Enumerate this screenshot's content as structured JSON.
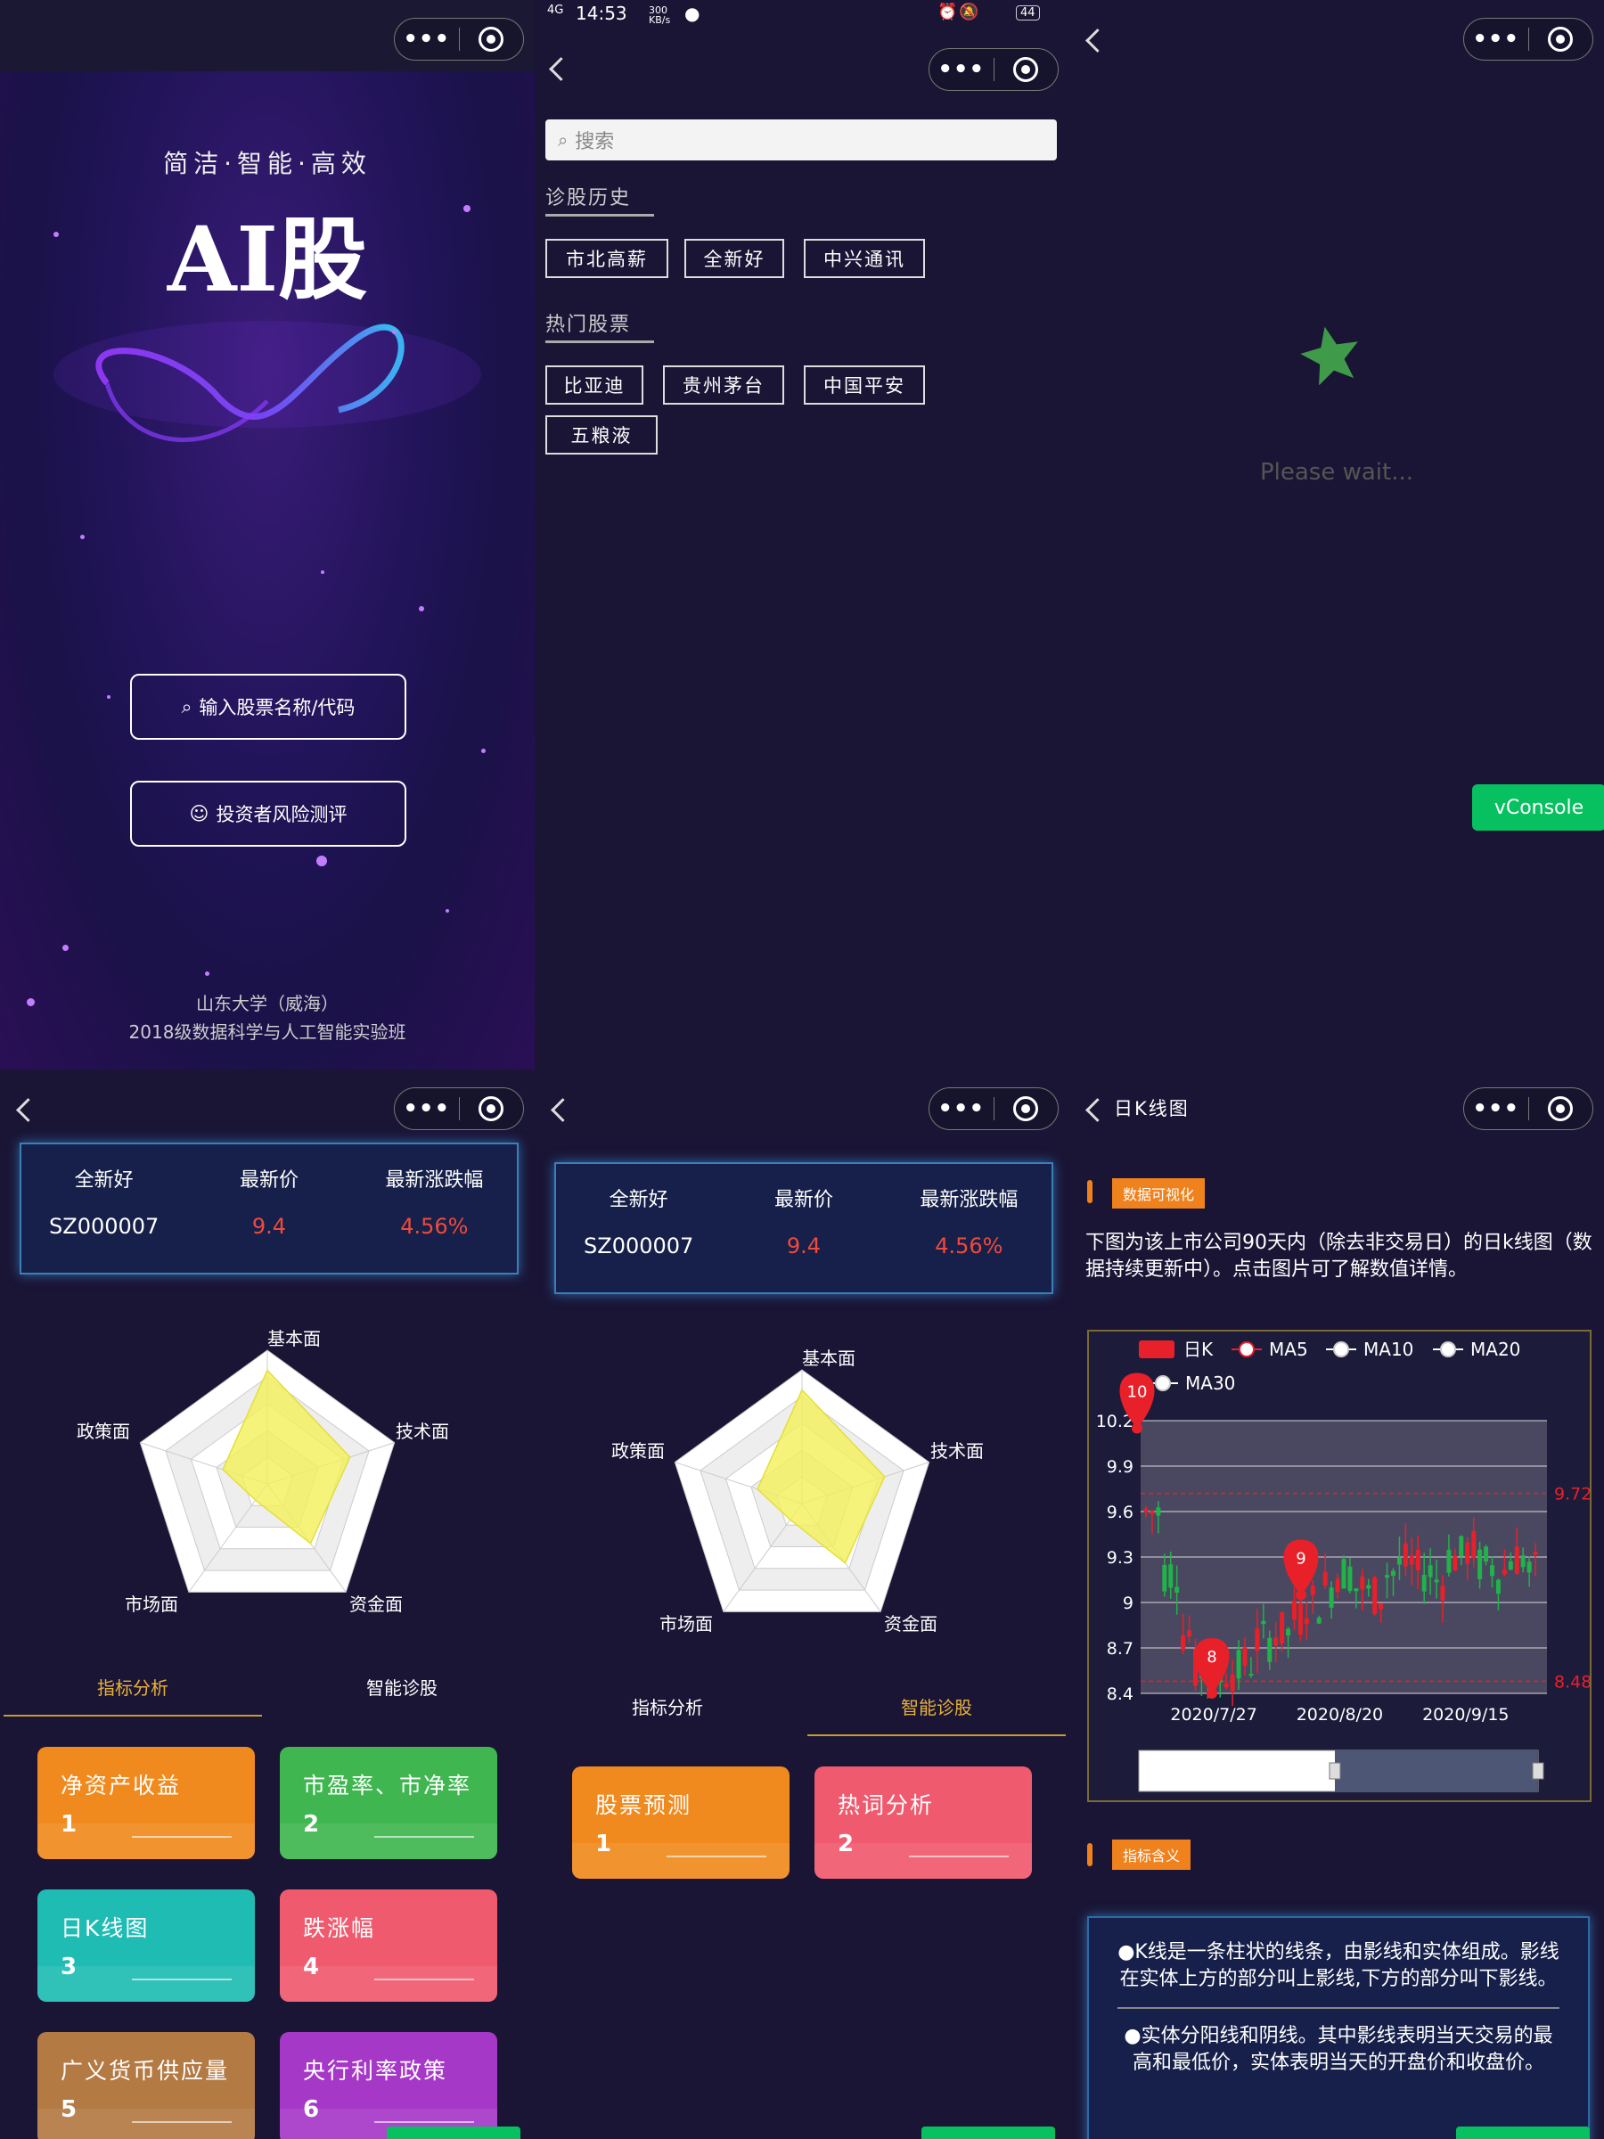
{
  "capsule": {
    "dots": "•••"
  },
  "home": {
    "slogan": "简洁·智能·高效",
    "brand": "AI股",
    "search_button": "输入股票名称/代码",
    "risk_button": "投资者风险测评",
    "footer_line1": "山东大学（威海）",
    "footer_line2": "2018级数据科学与人工智能实验班"
  },
  "status_bar": {
    "signal": "4G",
    "time": "14:53",
    "speed": "300 KB/s",
    "battery": "44"
  },
  "search_page": {
    "placeholder": "搜索",
    "history_title": "诊股历史",
    "history": [
      "市北高薪",
      "全新好",
      "中兴通讯"
    ],
    "hot_title": "热门股票",
    "hot": [
      "比亚迪",
      "贵州茅台",
      "中国平安",
      "五粮液"
    ]
  },
  "loading": {
    "text": "Please wait...",
    "vconsole": "vConsole"
  },
  "stock": {
    "headers": [
      "全新好",
      "最新价",
      "最新涨跌幅"
    ],
    "code": "SZ000007",
    "price": "9.4",
    "change": "4.56%"
  },
  "radar": {
    "labels": [
      "基本面",
      "技术面",
      "资金面",
      "市场面",
      "政策面"
    ],
    "values": [
      0.85,
      0.65,
      0.55,
      0.15,
      0.35
    ]
  },
  "tabs": {
    "analysis": "指标分析",
    "diagnosis": "智能诊股"
  },
  "analysis_cards": [
    {
      "title": "净资产收益",
      "num": "1",
      "color": "#f08a1e"
    },
    {
      "title": "市盈率、市净率",
      "num": "2",
      "color": "#3fb650"
    },
    {
      "title": "日K线图",
      "num": "3",
      "color": "#1fbcb4"
    },
    {
      "title": "跌涨幅",
      "num": "4",
      "color": "#f05a6e"
    },
    {
      "title": "广义货币供应量",
      "num": "5",
      "color": "#b47a44"
    },
    {
      "title": "央行利率政策",
      "num": "6",
      "color": "#a638c8"
    }
  ],
  "diagnosis_cards": [
    {
      "title": "股票预测",
      "num": "1",
      "color": "#f08a1e"
    },
    {
      "title": "热词分析",
      "num": "2",
      "color": "#f05a6e"
    }
  ],
  "kline": {
    "page_title": "日K线图",
    "badge_visual": "数据可视化",
    "description": "下图为该上市公司90天内（除去非交易日）的日k线图（数据持续更新中）。点击图片可了解数值详情。",
    "badge_meaning": "指标含义",
    "meaning_1": "●K线是一条柱状的线条，由影线和实体组成。影线在实体上方的部分叫上影线,下方的部分叫下影线。",
    "meaning_2": "●实体分阳线和阴线。其中影线表明当天交易的最高和最低价，实体表明当天的开盘价和收盘价。"
  },
  "chart_data": {
    "type": "candlestick",
    "legend": [
      "日K",
      "MA5",
      "MA10",
      "MA20",
      "MA30"
    ],
    "y_ticks": [
      "10.2",
      "9.9",
      "9.6",
      "9.3",
      "9",
      "8.7",
      "8.4"
    ],
    "ylim": [
      8.4,
      10.2
    ],
    "x_ticks": [
      "2020/7/27",
      "2020/8/20",
      "2020/9/15"
    ],
    "markLines": [
      "9.72",
      "8.48"
    ],
    "markPoints": [
      "10",
      "8",
      "9"
    ],
    "colors": {
      "up": "#e8202a",
      "down": "#21b24a"
    }
  }
}
